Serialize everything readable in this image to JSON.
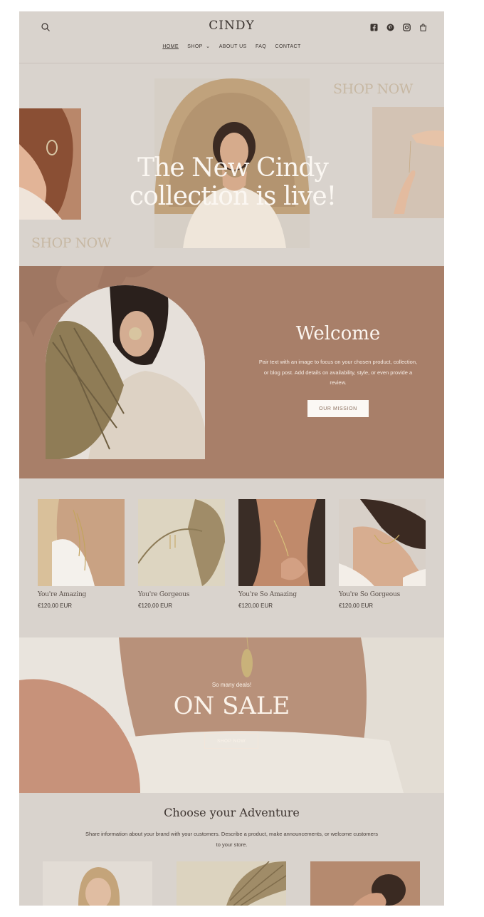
{
  "header": {
    "logo": "CINDY",
    "nav": [
      "HOME",
      "SHOP",
      "ABOUT US",
      "FAQ",
      "CONTACT"
    ],
    "icons": [
      "search-icon",
      "facebook-icon",
      "pinterest-icon",
      "instagram-icon",
      "cart-icon"
    ]
  },
  "hero": {
    "shop_now_top": "SHOP NOW",
    "shop_now_bottom": "SHOP NOW",
    "title_line1": "The New Cindy",
    "title_line2": "collection is live!"
  },
  "welcome": {
    "title": "Welcome",
    "text": "Pair text with an image to focus on your chosen product, collection, or blog post. Add details on availability, style, or even provide a review.",
    "button": "OUR MISSION"
  },
  "products": [
    {
      "name": "You're Amazing",
      "price": "€120,00 EUR"
    },
    {
      "name": "You're Gorgeous",
      "price": "€120,00 EUR"
    },
    {
      "name": "You're So Amazing",
      "price": "€120,00 EUR"
    },
    {
      "name": "You're So Gorgeous",
      "price": "€120,00 EUR"
    }
  ],
  "sale": {
    "subtitle": "So many deals!",
    "title": "ON SALE",
    "button": "SHOP NOW"
  },
  "adventure": {
    "title": "Choose your Adventure",
    "text": "Share information about your brand with your customers. Describe a product, make announcements, or welcome customers to your store."
  },
  "colors": {
    "page_bg": "#d9d3cd",
    "welcome_bg": "#a87f69",
    "accent_text": "#c7b8a3"
  }
}
